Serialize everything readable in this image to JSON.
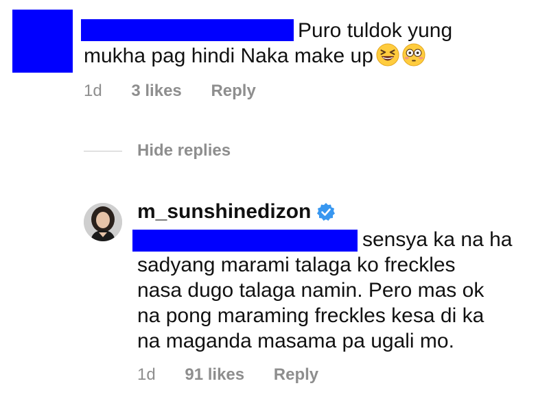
{
  "comment": {
    "text_line1": "Puro tuldok yung",
    "text_line2": "mukha pag hindi Naka make up",
    "emojis": [
      "grinning-squinting-face",
      "flushed-face"
    ],
    "time": "1d",
    "likes": "3 likes",
    "reply_label": "Reply"
  },
  "replies_toggle": {
    "label": "Hide replies"
  },
  "reply": {
    "username": "m_sunshinedizon",
    "verified": true,
    "text_line1": "sensya ka na ha",
    "text_line2": "sadyang marami talaga ko freckles",
    "text_line3": "nasa dugo talaga namin. Pero mas ok",
    "text_line4": "na pong maraming freckles kesa di ka",
    "text_line5": "na maganda masama pa ugali mo.",
    "time": "1d",
    "likes": "91 likes",
    "reply_label": "Reply"
  },
  "colors": {
    "redaction": "#0000ff",
    "meta_text": "#8e8e8e",
    "verified_badge": "#3897f0"
  }
}
